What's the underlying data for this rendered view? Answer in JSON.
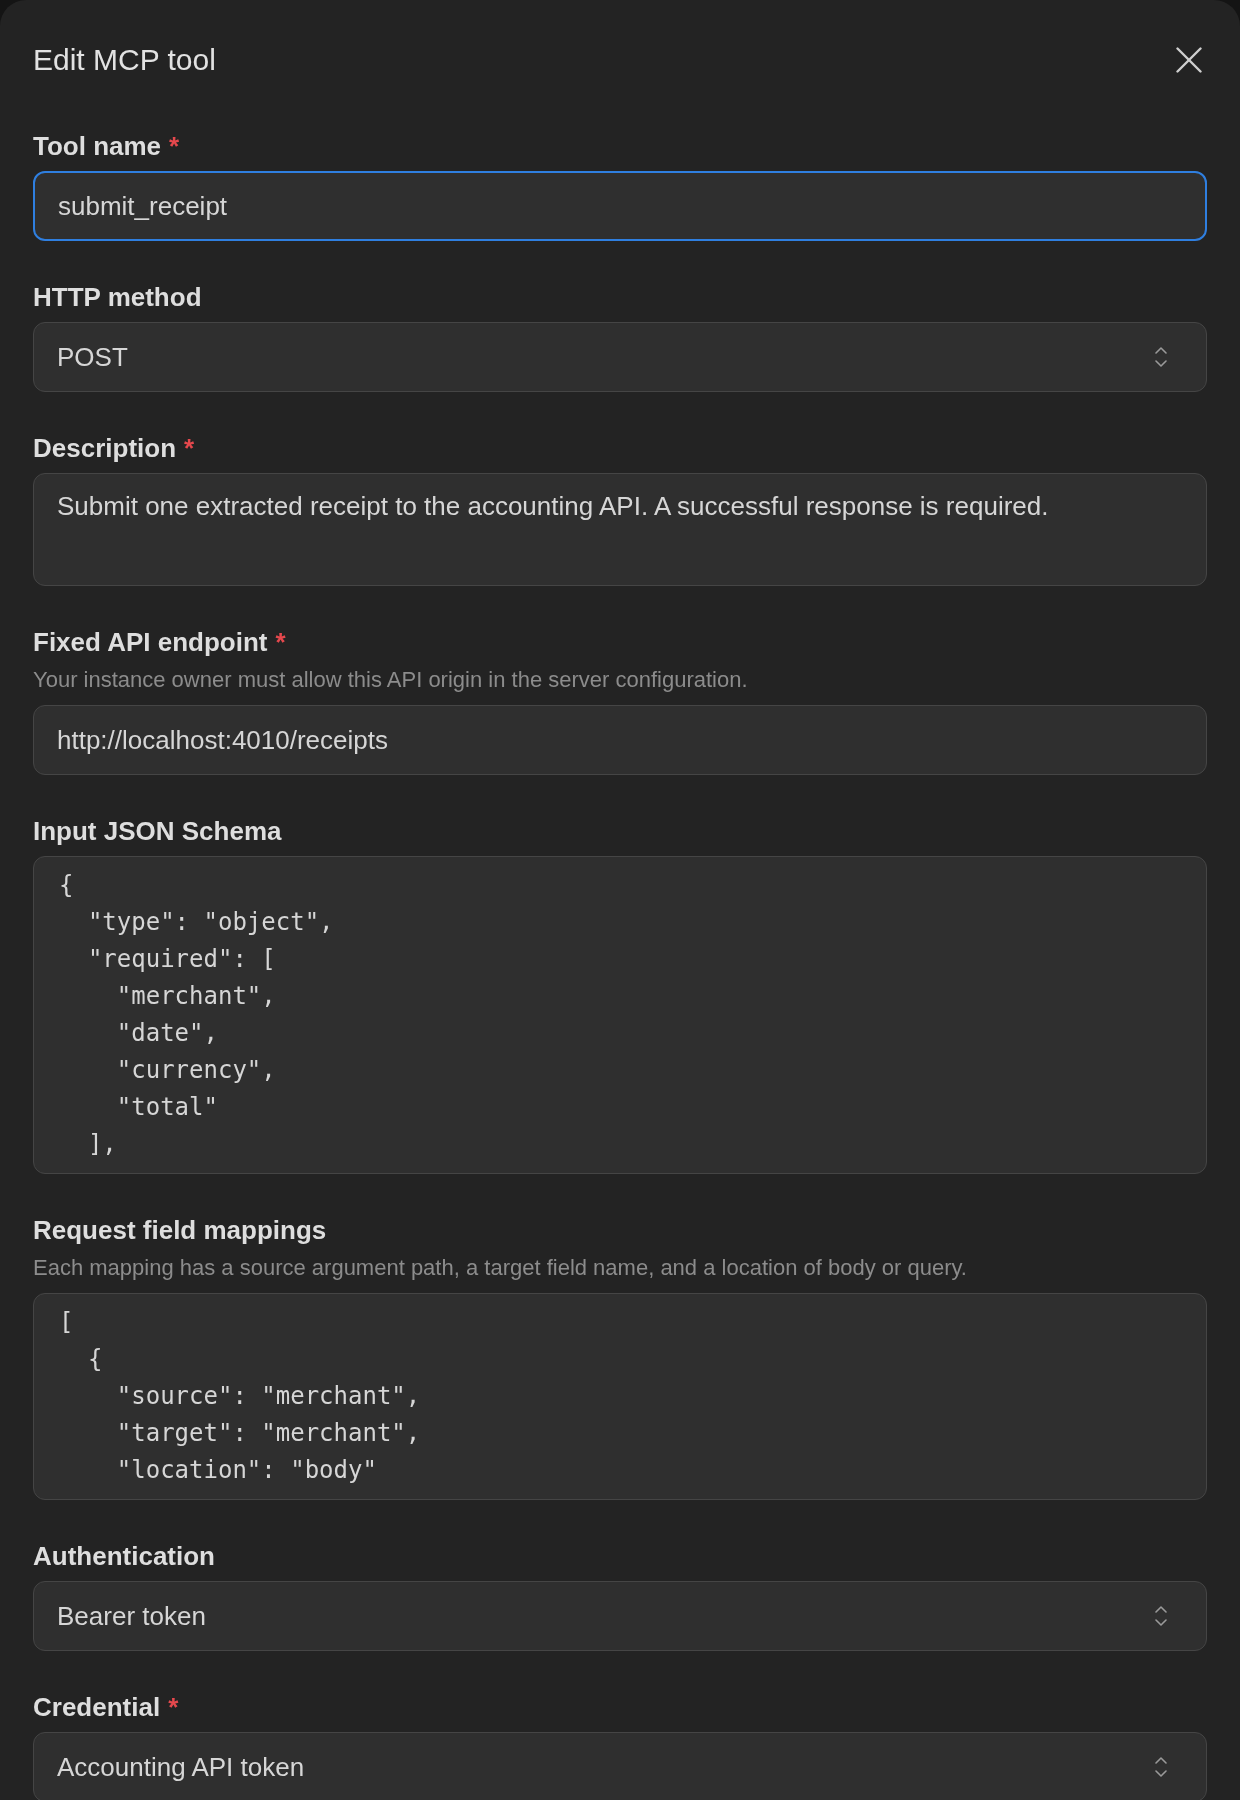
{
  "dialog": {
    "title": "Edit MCP tool"
  },
  "fields": [
    {
      "kind": "text",
      "label": "Tool name",
      "required_mark": "*",
      "value": "submit_receipt",
      "focused": true
    },
    {
      "kind": "select",
      "label": "HTTP method",
      "value": "POST",
      "focused": false
    },
    {
      "kind": "textarea",
      "label": "Description",
      "required_mark": "*",
      "value": "Submit one extracted receipt to the accounting API. A successful response is required.",
      "focused": false
    },
    {
      "kind": "text",
      "label": "Fixed API endpoint",
      "required_mark": "*",
      "help": "Your instance owner must allow this API origin in the server configuration.",
      "value": "http://localhost:4010/receipts",
      "focused": false
    },
    {
      "kind": "code",
      "label": "Input JSON Schema",
      "value": "{\n  \"type\": \"object\",\n  \"required\": [\n    \"merchant\",\n    \"date\",\n    \"currency\",\n    \"total\"\n  ],",
      "focused": false
    },
    {
      "kind": "code",
      "label": "Request field mappings",
      "help": "Each mapping has a source argument path, a target field name, and a location of body or query.",
      "value": "[\n  {\n    \"source\": \"merchant\",\n    \"target\": \"merchant\",\n    \"location\": \"body\"",
      "focused": false
    },
    {
      "kind": "select",
      "label": "Authentication",
      "value": "Bearer token",
      "focused": false
    },
    {
      "kind": "select",
      "label": "Credential",
      "required_mark": "*",
      "value": "Accounting API token",
      "focused": false
    }
  ]
}
